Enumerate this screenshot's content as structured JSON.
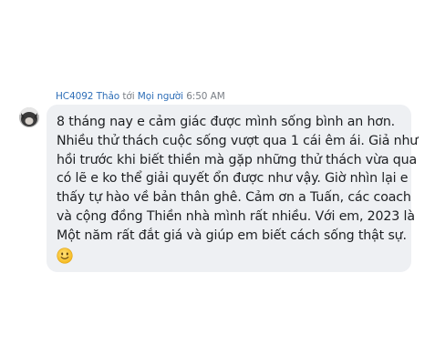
{
  "post": {
    "sender": "HC4092 Thảo",
    "to_word": "tới",
    "recipient": "Mọi người",
    "time": "6:50 AM",
    "message_lines": [
      "8 tháng nay e cảm giác được mình sống bình an hơn.",
      "Nhiều thử thách cuộc sống vượt qua 1 cái êm ái. Giả như",
      "hồi trước khi biết thiền mà gặp những thử thách vừa qua",
      "có lẽ e ko thể giải quyết ổn được như vậy.  Giờ nhìn lại e",
      "thấy tự hào về bản thân ghê. Cảm ơn a Tuấn, các coach",
      "và cộng đồng Thiền nhà mình rất nhiều. Với em, 2023 là",
      "Một năm rất đắt giá và giúp em biết cách sống thật sự."
    ],
    "emoji_icon": "slightly-smiling-face-icon"
  }
}
